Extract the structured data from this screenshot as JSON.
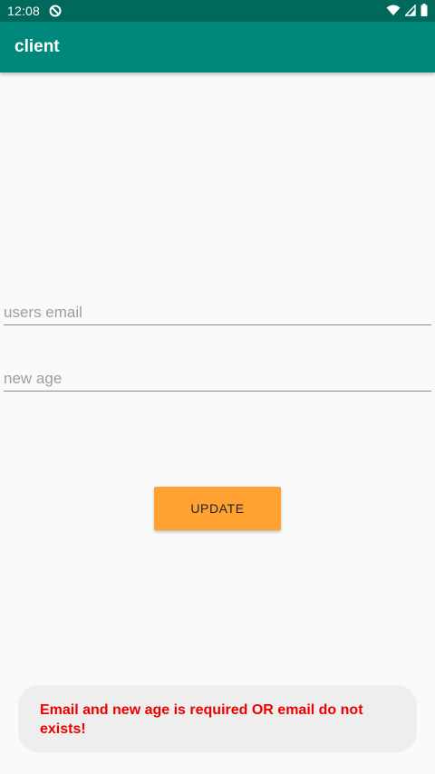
{
  "status_bar": {
    "time": "12:08",
    "app_icon": "sync-blocked-icon",
    "icons": [
      "wifi-icon",
      "cellular-signal-icon",
      "battery-icon"
    ]
  },
  "app_bar": {
    "title": "client"
  },
  "form": {
    "email_placeholder": "users email",
    "email_value": "",
    "age_placeholder": "new age",
    "age_value": "",
    "update_label": "UPDATE"
  },
  "toast": {
    "message": "Email and new age is required OR email do not exists!"
  },
  "colors": {
    "status_bar": "#00695c",
    "app_bar": "#00897b",
    "button": "#ffa232",
    "toast_text": "#ee0000"
  }
}
